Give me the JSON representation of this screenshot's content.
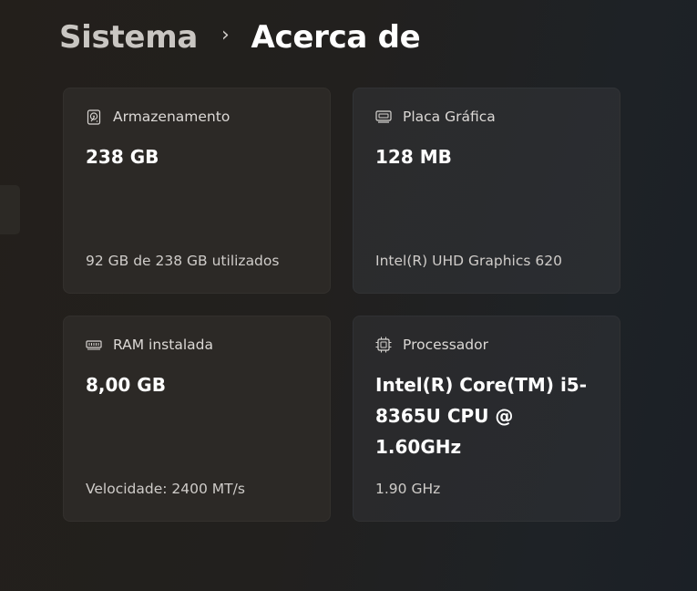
{
  "breadcrumb": {
    "parent": "Sistema",
    "separator": "›",
    "current": "Acerca de"
  },
  "cards": {
    "storage": {
      "icon": "hard-drive-icon",
      "title": "Armazenamento",
      "value": "238 GB",
      "detail": "92 GB de 238 GB utilizados"
    },
    "graphics": {
      "icon": "display-card-icon",
      "title": "Placa Gráfica",
      "value": "128 MB",
      "detail": "Intel(R) UHD Graphics 620"
    },
    "ram": {
      "icon": "memory-icon",
      "title": "RAM instalada",
      "value": "8,00 GB",
      "detail": "Velocidade: 2400 MT/s"
    },
    "processor": {
      "icon": "processor-chip-icon",
      "title": "Processador",
      "value": "Intel(R) Core(TM) i5-8365U CPU @ 1.60GHz",
      "detail": "1.90 GHz"
    }
  }
}
